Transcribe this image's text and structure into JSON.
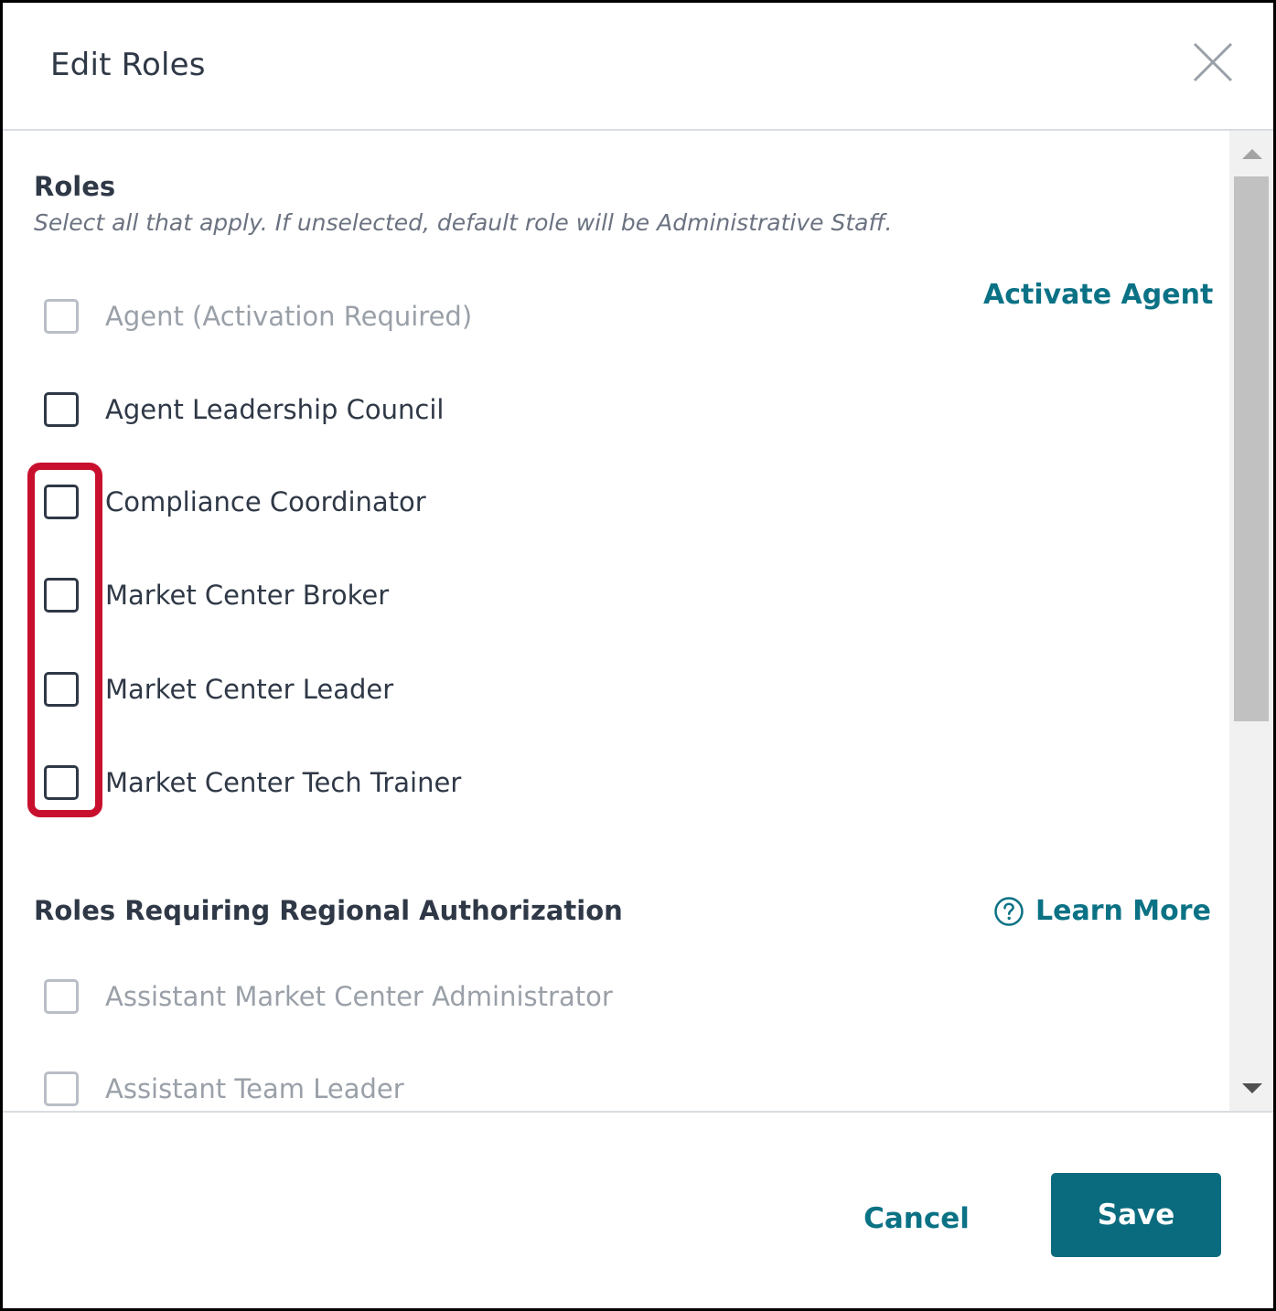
{
  "dialog": {
    "title": "Edit Roles",
    "close_icon": "close-icon"
  },
  "roles_section": {
    "title": "Roles",
    "subtitle": "Select all that apply. If unselected, default role will be Administrative Staff.",
    "activate_link": "Activate Agent",
    "items": [
      {
        "label": "Agent (Activation Required)",
        "checked": false,
        "disabled": true
      },
      {
        "label": "Agent Leadership Council",
        "checked": false,
        "disabled": false
      },
      {
        "label": "Compliance Coordinator",
        "checked": false,
        "disabled": false
      },
      {
        "label": "Market Center Broker",
        "checked": false,
        "disabled": false
      },
      {
        "label": "Market Center Leader",
        "checked": false,
        "disabled": false
      },
      {
        "label": "Market Center Tech Trainer",
        "checked": false,
        "disabled": false
      }
    ]
  },
  "regional_section": {
    "title": "Roles Requiring Regional Authorization",
    "learn_more_link": "Learn More",
    "learn_more_icon": "help-circle-icon",
    "items": [
      {
        "label": "Assistant Market Center Administrator",
        "checked": false,
        "disabled": true
      },
      {
        "label": "Assistant Team Leader",
        "checked": false,
        "disabled": true
      }
    ]
  },
  "footer": {
    "cancel_label": "Cancel",
    "save_label": "Save"
  },
  "colors": {
    "accent": "#0b7285",
    "save_button": "#0b6b7e",
    "highlight": "#c8102e",
    "text": "#2f3846",
    "muted_text": "#9aa0a8"
  }
}
